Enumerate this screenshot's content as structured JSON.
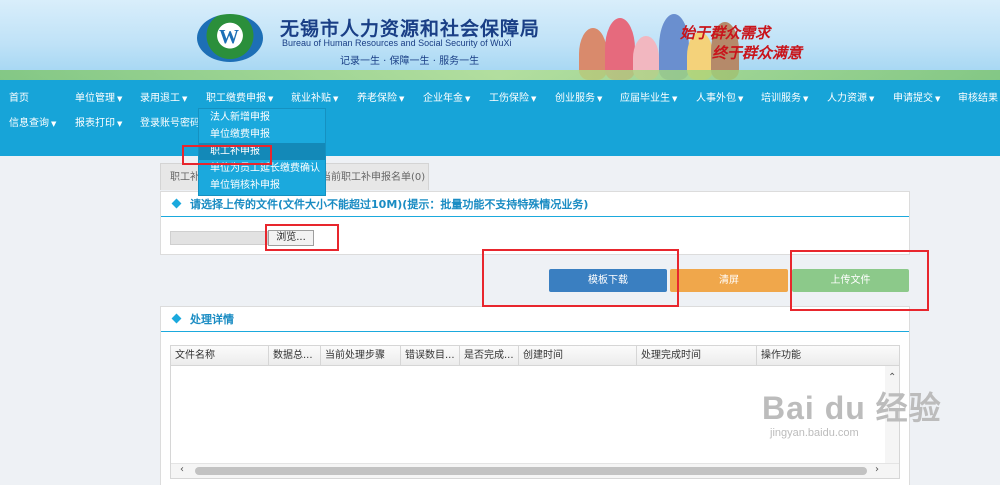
{
  "banner": {
    "logo_letter": "W",
    "title_cn": "无锡市人力资源和社会保障局",
    "title_en": "Bureau of Human Resources and Social Security of WuXi",
    "slogan": "记录一生 · 保障一生 · 服务一生",
    "calligraphy_1": "始于群众需求",
    "calligraphy_2": "终于群众满意"
  },
  "nav": {
    "row1": [
      {
        "label": "首页",
        "caret": ""
      },
      {
        "label": "单位管理",
        "caret": "▼"
      },
      {
        "label": "录用退工",
        "caret": "▼"
      },
      {
        "label": "职工缴费申报",
        "caret": "▼"
      },
      {
        "label": "就业补贴",
        "caret": "▼"
      },
      {
        "label": "养老保险",
        "caret": "▼"
      },
      {
        "label": "企业年金",
        "caret": "▼"
      },
      {
        "label": "工伤保险",
        "caret": "▼"
      },
      {
        "label": "创业服务",
        "caret": "▼"
      },
      {
        "label": "应届毕业生",
        "caret": "▼"
      },
      {
        "label": "人事外包",
        "caret": "▼"
      },
      {
        "label": "培训服务",
        "caret": "▼"
      },
      {
        "label": "人力资源",
        "caret": "▼"
      },
      {
        "label": "申请提交",
        "caret": "▼"
      },
      {
        "label": "审核结果",
        "caret": ""
      }
    ],
    "row2": [
      {
        "label": "信息查询",
        "caret": "▼"
      },
      {
        "label": "报表打印",
        "caret": "▼"
      },
      {
        "label": "登录账号密码",
        "caret": ""
      }
    ]
  },
  "dropdown": {
    "items": [
      "法人新增申报",
      "单位缴费申报",
      "职工补申报",
      "单位为员工延长缴费确认",
      "单位销核补申报"
    ],
    "active_index": 2
  },
  "tabs": [
    "职工补申报",
    "当前职工补申报名单(0)"
  ],
  "upload_panel": {
    "heading": "请选择上传的文件(文件大小不能超过10M)(提示：批量功能不支持特殊情况业务)",
    "file_value": "",
    "browse_label": "浏览..."
  },
  "buttons": {
    "template_download": "模板下载",
    "clear": "清屏",
    "upload": "上传文件"
  },
  "details_panel": {
    "heading": "处理详情",
    "columns": [
      "文件名称",
      "数据总...",
      "当前处理步骤",
      "错误数目...",
      "是否完成...",
      "创建时间",
      "处理完成时间",
      "操作功能"
    ],
    "rows": []
  },
  "watermark": {
    "brand": "Bai  du 经验",
    "url": "jingyan.baidu.com"
  },
  "colors": {
    "nav_bg": "#17a4d8",
    "annotation_red": "#e8262d",
    "template_btn": "#3a7fc1",
    "clear_btn": "#f0a74b",
    "upload_btn": "#8cc98a"
  }
}
